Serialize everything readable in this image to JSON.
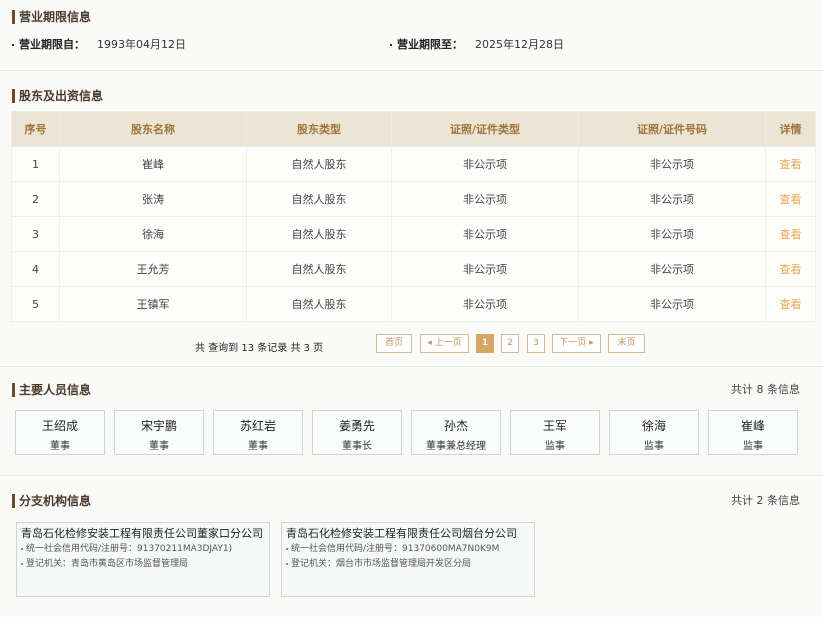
{
  "business_term": {
    "title": "营业期限信息",
    "from_label": "营业期限自：",
    "from_value": "1993年04月12日",
    "to_label": "营业期限至：",
    "to_value": "2025年12月28日"
  },
  "shareholders": {
    "title": "股东及出资信息",
    "columns": [
      "序号",
      "股东名称",
      "股东类型",
      "证照/证件类型",
      "证照/证件号码",
      "详情"
    ],
    "rows": [
      [
        "1",
        "崔峰",
        "自然人股东",
        "非公示项",
        "非公示项",
        "查看"
      ],
      [
        "2",
        "张涛",
        "自然人股东",
        "非公示项",
        "非公示项",
        "查看"
      ],
      [
        "3",
        "徐海",
        "自然人股东",
        "非公示项",
        "非公示项",
        "查看"
      ],
      [
        "4",
        "王允芳",
        "自然人股东",
        "非公示项",
        "非公示项",
        "查看"
      ],
      [
        "5",
        "王镇军",
        "自然人股东",
        "非公示项",
        "非公示项",
        "查看"
      ]
    ],
    "pager": {
      "info": "共 查询到 13 条记录 共 3 页",
      "first": "首页",
      "prev": "◂ 上一页",
      "pages": [
        "1",
        "2",
        "3"
      ],
      "current": "1",
      "next": "下一页 ▸",
      "last": "末页"
    }
  },
  "personnel": {
    "title": "主要人员信息",
    "count": "共计 8 条信息",
    "items": [
      {
        "name": "王绍成",
        "role": "董事"
      },
      {
        "name": "宋宇鹏",
        "role": "董事"
      },
      {
        "name": "苏红岩",
        "role": "董事"
      },
      {
        "name": "姜勇先",
        "role": "董事长"
      },
      {
        "name": "孙杰",
        "role": "董事兼总经理"
      },
      {
        "name": "王军",
        "role": "监事"
      },
      {
        "name": "徐海",
        "role": "监事"
      },
      {
        "name": "崔峰",
        "role": "监事"
      }
    ]
  },
  "branches": {
    "title": "分支机构信息",
    "count": "共计 2 条信息",
    "items": [
      {
        "name": "青岛石化检修安装工程有限责任公司董家口分公司",
        "code": "统一社会信用代码/注册号：91370211MA3DJAY1)",
        "authority": "登记机关：青岛市黄岛区市场监督管理局"
      },
      {
        "name": "青岛石化检修安装工程有限责任公司烟台分公司",
        "code": "统一社会信用代码/注册号：91370600MA7N0K9M",
        "authority": "登记机关：烟台市市场监督管理局开发区分局"
      }
    ]
  }
}
